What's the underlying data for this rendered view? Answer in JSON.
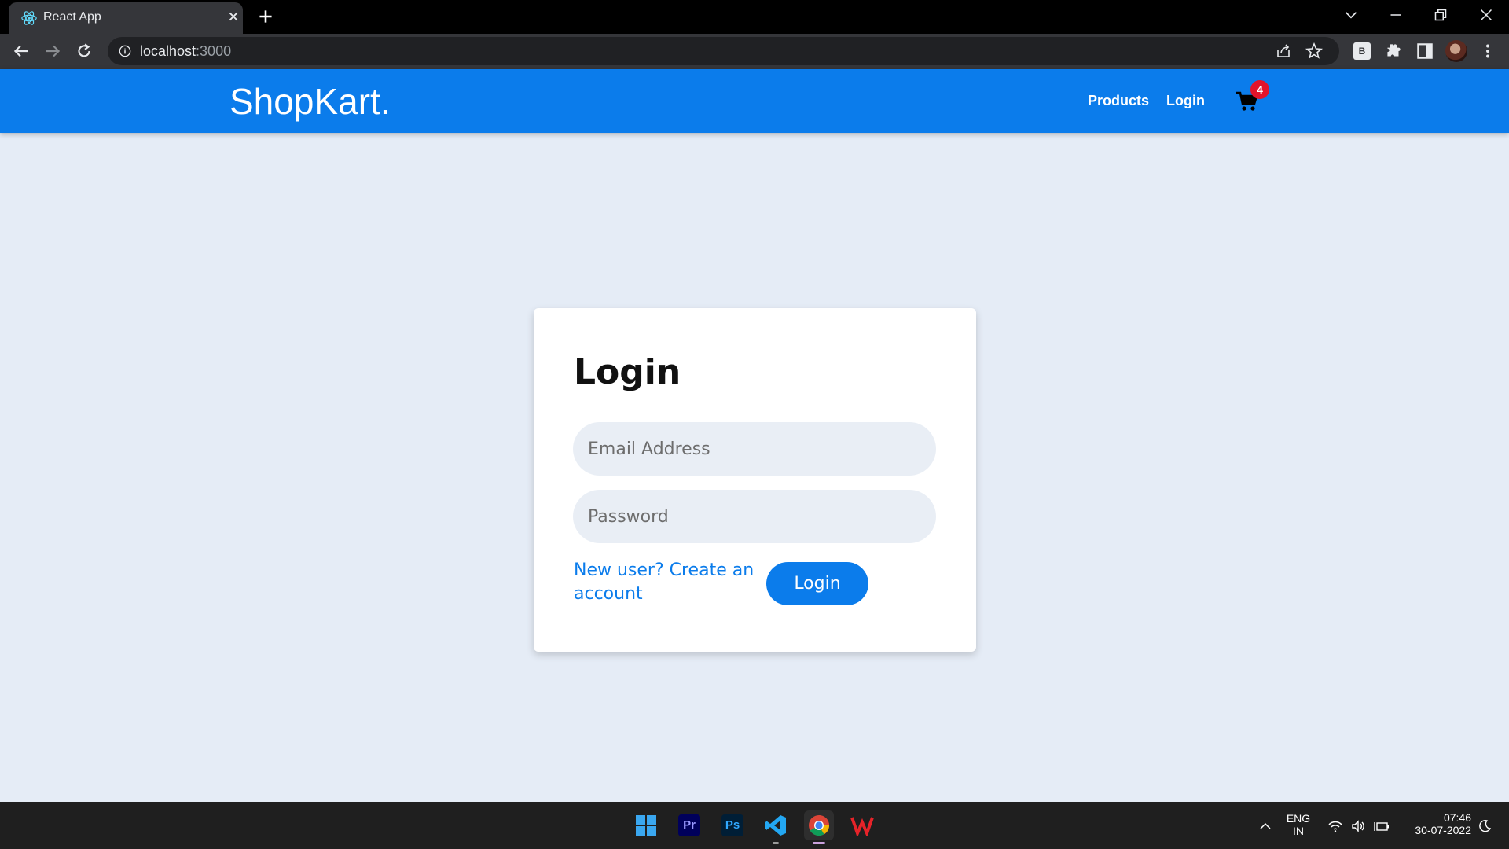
{
  "browser": {
    "tab_title": "React App",
    "url_host": "localhost",
    "url_port": ":3000"
  },
  "app": {
    "brand": "ShopKart.",
    "nav": {
      "products": "Products",
      "login": "Login"
    },
    "cart_count": "4",
    "colors": {
      "primary": "#0b7ceb",
      "badge": "#e3132b",
      "background": "#e5ecf6"
    }
  },
  "login_form": {
    "heading": "Login",
    "email_placeholder": "Email Address",
    "password_placeholder": "Password",
    "signup_link": "New user? Create an account",
    "submit_label": "Login"
  },
  "taskbar": {
    "apps": [
      "windows-start-icon",
      "premiere-icon",
      "photoshop-icon",
      "vscode-icon",
      "chrome-icon",
      "wps-icon"
    ],
    "premiere_label": "Pr",
    "photoshop_label": "Ps",
    "lang_top": "ENG",
    "lang_bottom": "IN",
    "time": "07:46",
    "date": "30-07-2022"
  }
}
